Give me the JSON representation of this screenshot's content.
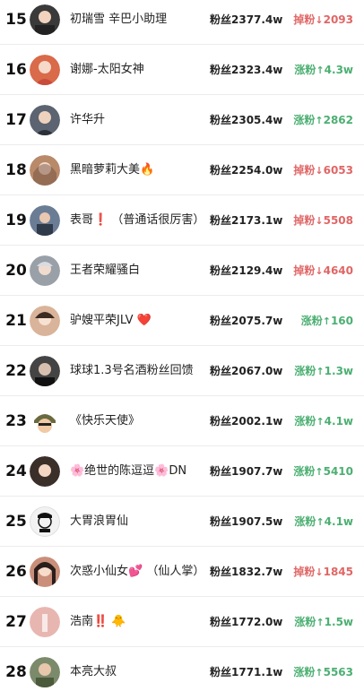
{
  "rows": [
    {
      "rank": "15",
      "name": "初瑞雪 辛巴小助理",
      "fans": "粉丝2377.4w",
      "dir": "down",
      "delta_label": "掉粉",
      "delta_value": "2093",
      "avatar_color": "#3a3a3a"
    },
    {
      "rank": "16",
      "name": "谢娜-太阳女神",
      "fans": "粉丝2323.4w",
      "dir": "up",
      "delta_label": "涨粉",
      "delta_value": "4.3w",
      "avatar_color": "#d96a4a"
    },
    {
      "rank": "17",
      "name": "许华升",
      "fans": "粉丝2305.4w",
      "dir": "up",
      "delta_label": "涨粉",
      "delta_value": "2862",
      "avatar_color": "#5b6470"
    },
    {
      "rank": "18",
      "name": "黑暗萝莉大美🔥",
      "fans": "粉丝2254.0w",
      "dir": "down",
      "delta_label": "掉粉",
      "delta_value": "6053",
      "avatar_color": "#b88a6a"
    },
    {
      "rank": "19",
      "name": "表哥❗ （普通话很厉害）",
      "fans": "粉丝2173.1w",
      "dir": "down",
      "delta_label": "掉粉",
      "delta_value": "5508",
      "avatar_color": "#6b7d95"
    },
    {
      "rank": "20",
      "name": "王者荣耀骚白",
      "fans": "粉丝2129.4w",
      "dir": "down",
      "delta_label": "掉粉",
      "delta_value": "4640",
      "avatar_color": "#9aa0a8"
    },
    {
      "rank": "21",
      "name": "驴嫂平荣JLV ❤️",
      "fans": "粉丝2075.7w",
      "dir": "up",
      "delta_label": "涨粉",
      "delta_value": "160",
      "avatar_color": "#d9b49a"
    },
    {
      "rank": "22",
      "name": "球球1.3号名酒粉丝回馈",
      "fans": "粉丝2067.0w",
      "dir": "up",
      "delta_label": "涨粉",
      "delta_value": "1.3w",
      "avatar_color": "#444444"
    },
    {
      "rank": "23",
      "name": "《快乐天使》",
      "fans": "粉丝2002.1w",
      "dir": "up",
      "delta_label": "涨粉",
      "delta_value": "4.1w",
      "avatar_color": "#6a6a40"
    },
    {
      "rank": "24",
      "name": "🌸绝世的陈逗逗🌸DN",
      "fans": "粉丝1907.7w",
      "dir": "up",
      "delta_label": "涨粉",
      "delta_value": "5410",
      "avatar_color": "#3b2f2a"
    },
    {
      "rank": "25",
      "name": "大胃浪胃仙",
      "fans": "粉丝1907.5w",
      "dir": "up",
      "delta_label": "涨粉",
      "delta_value": "4.1w",
      "avatar_color": "#f2f2f2"
    },
    {
      "rank": "26",
      "name": "次惑小仙女💕 （仙人掌）",
      "fans": "粉丝1832.7w",
      "dir": "down",
      "delta_label": "掉粉",
      "delta_value": "1845",
      "avatar_color": "#c98f7a"
    },
    {
      "rank": "27",
      "name": "浩南‼️ 🐥",
      "fans": "粉丝1772.0w",
      "dir": "up",
      "delta_label": "涨粉",
      "delta_value": "1.5w",
      "avatar_color": "#e8b6b0"
    },
    {
      "rank": "28",
      "name": "本亮大叔",
      "fans": "粉丝1771.1w",
      "dir": "up",
      "delta_label": "涨粉",
      "delta_value": "5563",
      "avatar_color": "#7b8a6a"
    }
  ]
}
